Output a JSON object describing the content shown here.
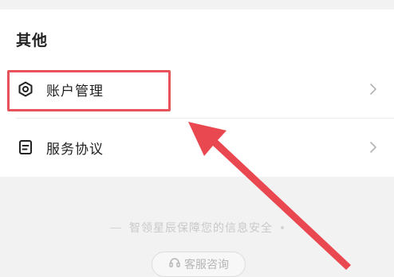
{
  "section": {
    "title": "其他"
  },
  "menu": {
    "items": [
      {
        "label": "账户管理",
        "icon": "hexagon-settings-icon"
      },
      {
        "label": "服务协议",
        "icon": "document-icon"
      }
    ]
  },
  "footer": {
    "security_note": "智领星辰保障您的信息安全",
    "service_button_label": "客服咨询",
    "service_icon": "headset-icon"
  },
  "annotation": {
    "highlight_color": "#e8525a"
  }
}
